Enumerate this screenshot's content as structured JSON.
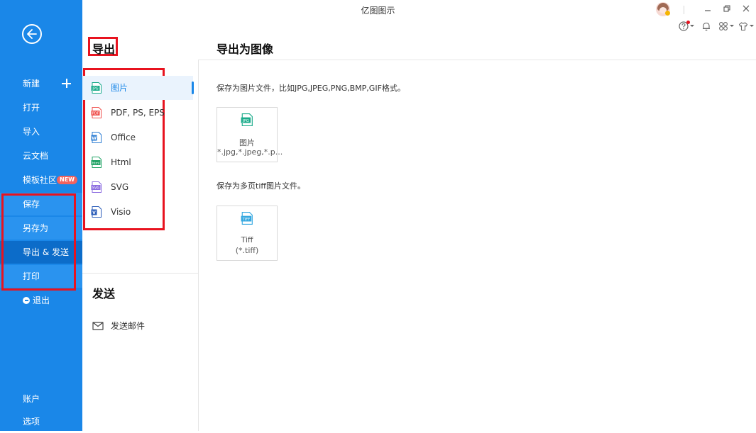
{
  "window": {
    "title": "亿图图示"
  },
  "sidebar": {
    "items": [
      {
        "label": "新建"
      },
      {
        "label": "打开"
      },
      {
        "label": "导入"
      },
      {
        "label": "云文档"
      },
      {
        "label": "模板社区",
        "badge": "NEW"
      },
      {
        "label": "保存"
      },
      {
        "label": "另存为"
      },
      {
        "label": "导出 & 发送"
      },
      {
        "label": "打印"
      },
      {
        "label": "退出"
      }
    ],
    "bottom": [
      {
        "label": "账户"
      },
      {
        "label": "选项"
      }
    ]
  },
  "export_panel": {
    "heading": "导出",
    "types": [
      {
        "label": "图片",
        "icon_text": "JPG"
      },
      {
        "label": "PDF, PS, EPS",
        "icon_text": "PDF"
      },
      {
        "label": "Office",
        "icon_text": "W"
      },
      {
        "label": "Html",
        "icon_text": "html"
      },
      {
        "label": "SVG",
        "icon_text": "SVG"
      },
      {
        "label": "Visio",
        "icon_text": "V"
      }
    ]
  },
  "send_panel": {
    "heading": "发送",
    "items": [
      {
        "label": "发送邮件"
      }
    ]
  },
  "content": {
    "heading": "导出为图像",
    "sections": [
      {
        "description": "保存为图片文件，比如JPG,JPEG,PNG,BMP,GIF格式。",
        "card": {
          "icon_text": "JPG",
          "line1": "图片",
          "line2": "*.jpg,*.jpeg,*.p..."
        }
      },
      {
        "description": "保存为多页tiff图片文件。",
        "card": {
          "icon_text": "TIFF",
          "line1": "Tiff",
          "line2": "(*.tiff)"
        }
      }
    ]
  },
  "colors": {
    "sidebar_bg": "#1a87e8",
    "sidebar_active": "#0c6cc9",
    "accent": "#1a87e8",
    "highlight_frame": "#e8131f",
    "new_badge": "#f2635f",
    "jpg_icon": "#1aab8a",
    "pdf_icon": "#f0524f",
    "word_icon": "#2b7cd3",
    "html_icon": "#21a366",
    "svg_icon": "#8a6ae0",
    "visio_icon": "#2a5cb8",
    "tiff_icon": "#35a8e0"
  }
}
